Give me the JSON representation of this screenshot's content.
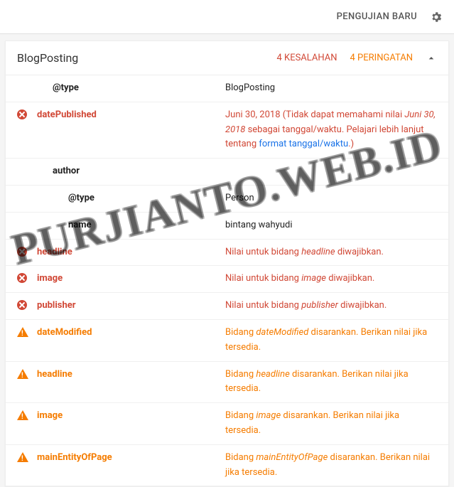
{
  "topbar": {
    "new_test_label": "PENGUJIAN BARU"
  },
  "section": {
    "title": "BlogPosting",
    "errors_label": "4 KESALAHAN",
    "warnings_label": "4 PERINGATAN"
  },
  "rows": {
    "type_key": "@type",
    "type_val": "BlogPosting",
    "datePublished_key": "datePublished",
    "datePublished_pre": "Juni 30, 2018 (Tidak dapat memahami nilai ",
    "datePublished_em": "Juni 30, 2018",
    "datePublished_mid": " sebagai tanggal/waktu. Pelajari lebih lanjut tentang ",
    "datePublished_link": "format tanggal/waktu",
    "datePublished_post": ".)",
    "author_key": "author",
    "author_type_key": "@type",
    "author_type_val": "Person",
    "author_name_key": "name",
    "author_name_val": "bintang wahyudi",
    "headline_err_key": "headline",
    "headline_err_pre": "Nilai untuk bidang ",
    "headline_err_em": "headline",
    "headline_err_post": " diwajibkan.",
    "image_err_key": "image",
    "image_err_pre": "Nilai untuk bidang ",
    "image_err_em": "image",
    "image_err_post": " diwajibkan.",
    "publisher_err_key": "publisher",
    "publisher_err_pre": "Nilai untuk bidang ",
    "publisher_err_em": "publisher",
    "publisher_err_post": " diwajibkan.",
    "dateModified_warn_key": "dateModified",
    "dateModified_warn_pre": "Bidang ",
    "dateModified_warn_em": "dateModified",
    "dateModified_warn_post": " disarankan. Berikan nilai jika tersedia.",
    "headline_warn_key": "headline",
    "headline_warn_pre": "Bidang ",
    "headline_warn_em": "headline",
    "headline_warn_post": " disarankan. Berikan nilai jika tersedia.",
    "image_warn_key": "image",
    "image_warn_pre": "Bidang ",
    "image_warn_em": "image",
    "image_warn_post": " disarankan. Berikan nilai jika tersedia.",
    "mainEntity_warn_key": "mainEntityOfPage",
    "mainEntity_warn_pre": "Bidang ",
    "mainEntity_warn_em": "mainEntityOfPage",
    "mainEntity_warn_post": " disarankan. Berikan nilai jika tersedia."
  },
  "watermark": "PURJIANTO.WEB.ID"
}
